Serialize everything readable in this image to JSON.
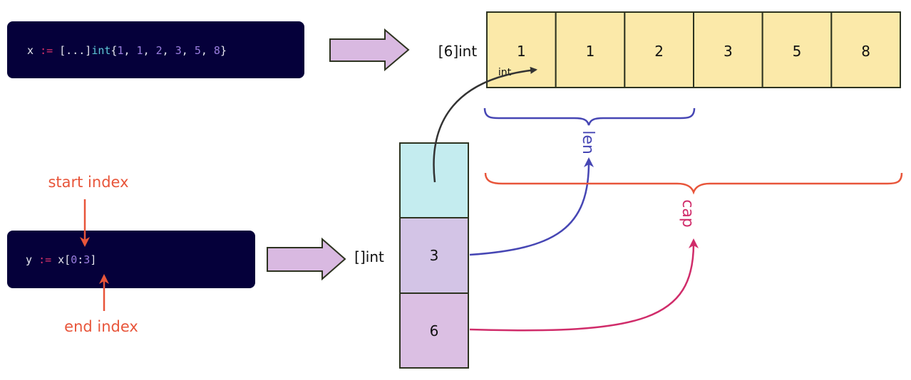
{
  "code1": {
    "var": "x ",
    "op": ":=",
    "open": " [...]",
    "type": "int",
    "brace_open": "{",
    "values": [
      "1",
      "1",
      "2",
      "3",
      "5",
      "8"
    ],
    "brace_close": "}"
  },
  "code2": {
    "var": "y ",
    "op": ":=",
    "expr": " x[",
    "start": "0",
    "colon": ":",
    "end": "3",
    "close": "]"
  },
  "array": {
    "type_label": "[6]int",
    "elem_type": "int",
    "cells": [
      "1",
      "1",
      "2",
      "3",
      "5",
      "8"
    ]
  },
  "slice": {
    "type_label": "[]int",
    "len": "3",
    "cap": "6"
  },
  "labels": {
    "start_index": "start index",
    "end_index": "end index",
    "len": "len",
    "cap": "cap"
  },
  "colors": {
    "code_bg": "#05003a",
    "array_fill": "#fbe9a9",
    "ptr_fill": "#c4ecef",
    "len_fill": "#d3c4e6",
    "cap_fill": "#dbbfe3",
    "arrow_fill": "#d9b9e1",
    "index": "#e8553a",
    "len": "#4646b4",
    "cap": "#d02c6a"
  }
}
